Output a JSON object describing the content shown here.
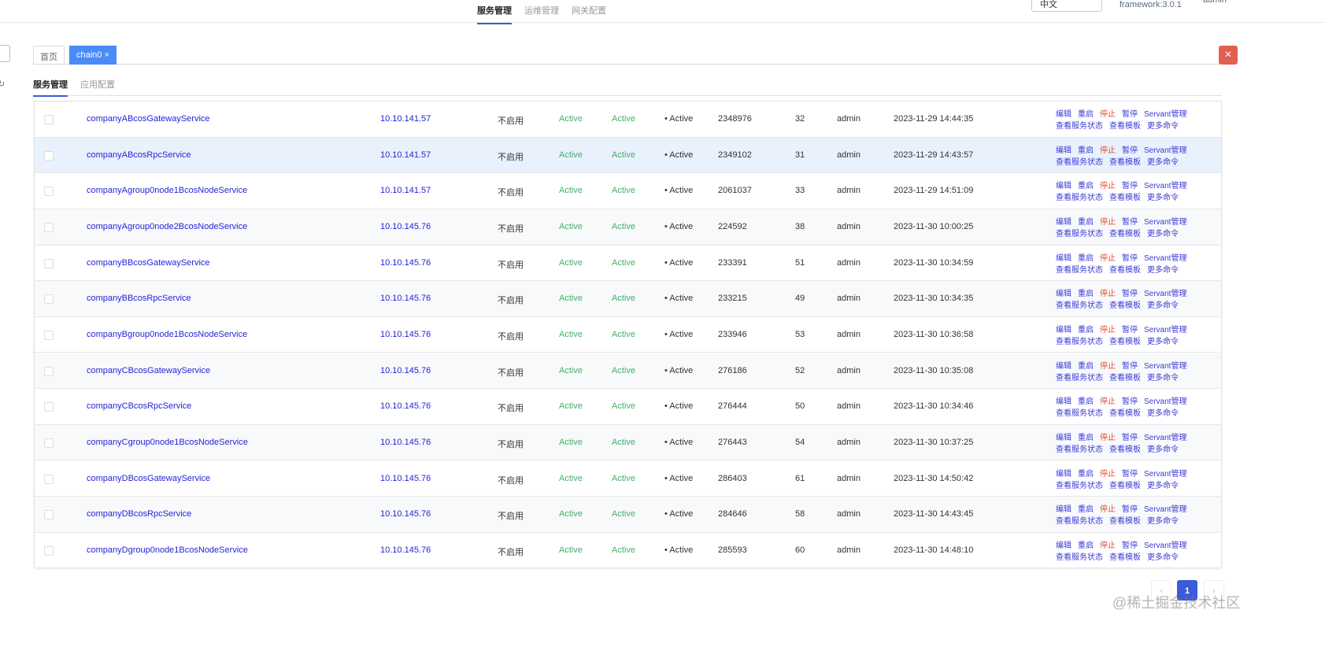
{
  "topnav": {
    "items": [
      "服务管理",
      "运维管理",
      "网关配置"
    ],
    "language": "中文",
    "framework": "framework:3.0.1",
    "user": "admin"
  },
  "tabs": {
    "home": "首页",
    "active": "chain0",
    "close": "×"
  },
  "subtabs": [
    "服务管理",
    "应用配置"
  ],
  "rows": [
    {
      "name": "companyABcosGatewayService",
      "ip": "10.10.141.57",
      "setting": "不启用",
      "s1": "Active",
      "s2": "Active",
      "s3": "• Active",
      "pid": "2348976",
      "num": "32",
      "user": "admin",
      "time": "2023-11-29 14:44:35"
    },
    {
      "name": "companyABcosRpcService",
      "ip": "10.10.141.57",
      "setting": "不启用",
      "s1": "Active",
      "s2": "Active",
      "s3": "• Active",
      "pid": "2349102",
      "num": "31",
      "user": "admin",
      "time": "2023-11-29 14:43:57"
    },
    {
      "name": "companyAgroup0node1BcosNodeService",
      "ip": "10.10.141.57",
      "setting": "不启用",
      "s1": "Active",
      "s2": "Active",
      "s3": "• Active",
      "pid": "2061037",
      "num": "33",
      "user": "admin",
      "time": "2023-11-29 14:51:09"
    },
    {
      "name": "companyAgroup0node2BcosNodeService",
      "ip": "10.10.145.76",
      "setting": "不启用",
      "s1": "Active",
      "s2": "Active",
      "s3": "• Active",
      "pid": "224592",
      "num": "38",
      "user": "admin",
      "time": "2023-11-30 10:00:25"
    },
    {
      "name": "companyBBcosGatewayService",
      "ip": "10.10.145.76",
      "setting": "不启用",
      "s1": "Active",
      "s2": "Active",
      "s3": "• Active",
      "pid": "233391",
      "num": "51",
      "user": "admin",
      "time": "2023-11-30 10:34:59"
    },
    {
      "name": "companyBBcosRpcService",
      "ip": "10.10.145.76",
      "setting": "不启用",
      "s1": "Active",
      "s2": "Active",
      "s3": "• Active",
      "pid": "233215",
      "num": "49",
      "user": "admin",
      "time": "2023-11-30 10:34:35"
    },
    {
      "name": "companyBgroup0node1BcosNodeService",
      "ip": "10.10.145.76",
      "setting": "不启用",
      "s1": "Active",
      "s2": "Active",
      "s3": "• Active",
      "pid": "233946",
      "num": "53",
      "user": "admin",
      "time": "2023-11-30 10:36:58"
    },
    {
      "name": "companyCBcosGatewayService",
      "ip": "10.10.145.76",
      "setting": "不启用",
      "s1": "Active",
      "s2": "Active",
      "s3": "• Active",
      "pid": "276186",
      "num": "52",
      "user": "admin",
      "time": "2023-11-30 10:35:08"
    },
    {
      "name": "companyCBcosRpcService",
      "ip": "10.10.145.76",
      "setting": "不启用",
      "s1": "Active",
      "s2": "Active",
      "s3": "• Active",
      "pid": "276444",
      "num": "50",
      "user": "admin",
      "time": "2023-11-30 10:34:46"
    },
    {
      "name": "companyCgroup0node1BcosNodeService",
      "ip": "10.10.145.76",
      "setting": "不启用",
      "s1": "Active",
      "s2": "Active",
      "s3": "• Active",
      "pid": "276443",
      "num": "54",
      "user": "admin",
      "time": "2023-11-30 10:37:25"
    },
    {
      "name": "companyDBcosGatewayService",
      "ip": "10.10.145.76",
      "setting": "不启用",
      "s1": "Active",
      "s2": "Active",
      "s3": "• Active",
      "pid": "286403",
      "num": "61",
      "user": "admin",
      "time": "2023-11-30 14:50:42"
    },
    {
      "name": "companyDBcosRpcService",
      "ip": "10.10.145.76",
      "setting": "不启用",
      "s1": "Active",
      "s2": "Active",
      "s3": "• Active",
      "pid": "284646",
      "num": "58",
      "user": "admin",
      "time": "2023-11-30 14:43:45"
    },
    {
      "name": "companyDgroup0node1BcosNodeService",
      "ip": "10.10.145.76",
      "setting": "不启用",
      "s1": "Active",
      "s2": "Active",
      "s3": "• Active",
      "pid": "285593",
      "num": "60",
      "user": "admin",
      "time": "2023-11-30 14:48:10"
    }
  ],
  "actions": {
    "line1": [
      "编辑",
      "重启",
      "停止",
      "暂停",
      "Servant管理"
    ],
    "line2": [
      "查看服务状态",
      "查看模板",
      "更多命令"
    ]
  },
  "pager": {
    "prev": "‹",
    "current": "1",
    "next": "›"
  },
  "watermark": "@稀土掘金技术社区",
  "colors": {
    "accent": "#3b5bdb",
    "active_tab": "#4a8cf7",
    "stop": "#e04a2a",
    "status_green": "#43b06a"
  }
}
